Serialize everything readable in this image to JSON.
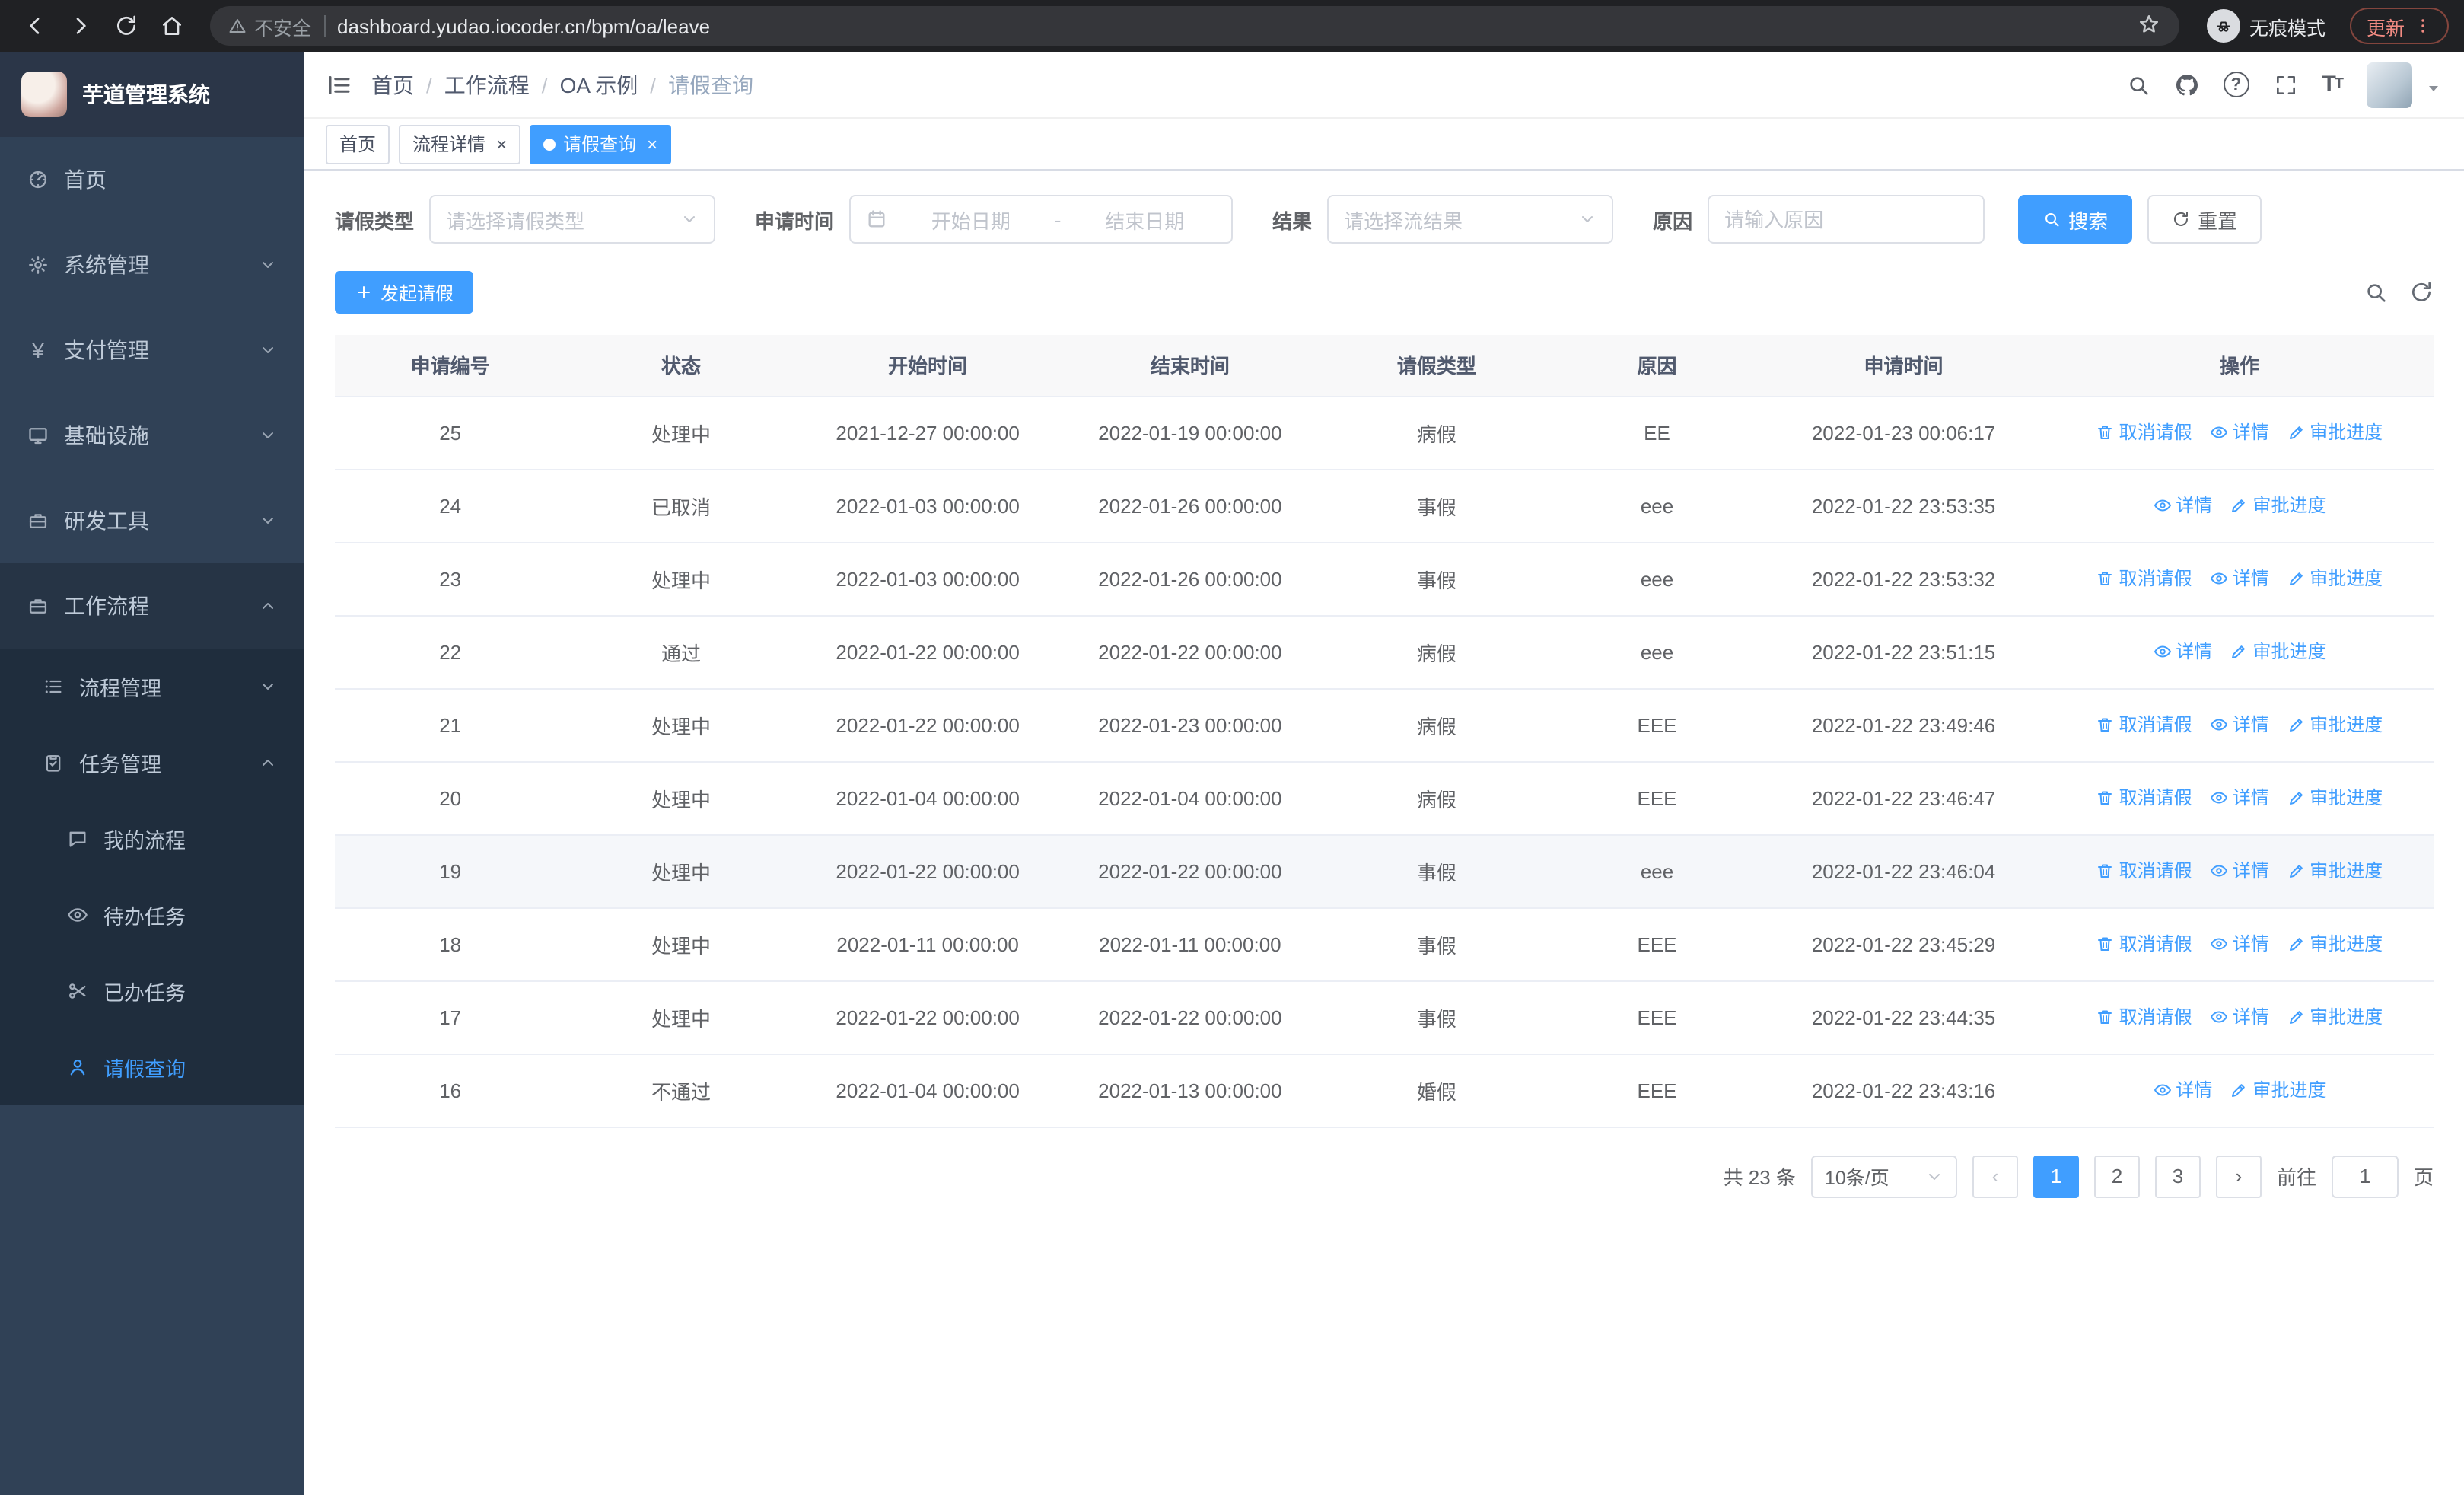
{
  "browser": {
    "security_label": "不安全",
    "url": "dashboard.yudao.iocoder.cn/bpm/oa/leave",
    "incognito_label": "无痕模式",
    "update_label": "更新"
  },
  "sidebar": {
    "logo_title": "芋道管理系统",
    "items": [
      {
        "label": "首页"
      },
      {
        "label": "系统管理"
      },
      {
        "label": "支付管理"
      },
      {
        "label": "基础设施"
      },
      {
        "label": "研发工具"
      },
      {
        "label": "工作流程"
      }
    ],
    "workflow_children": [
      {
        "label": "流程管理"
      },
      {
        "label": "任务管理"
      }
    ],
    "task_children": [
      {
        "label": "我的流程"
      },
      {
        "label": "待办任务"
      },
      {
        "label": "已办任务"
      },
      {
        "label": "请假查询"
      }
    ]
  },
  "header": {
    "breadcrumb": [
      "首页",
      "工作流程",
      "OA 示例",
      "请假查询"
    ]
  },
  "tabs": [
    {
      "label": "首页"
    },
    {
      "label": "流程详情"
    },
    {
      "label": "请假查询"
    }
  ],
  "filters": {
    "leave_type_label": "请假类型",
    "leave_type_placeholder": "请选择请假类型",
    "apply_time_label": "申请时间",
    "start_date_placeholder": "开始日期",
    "range_separator": "-",
    "end_date_placeholder": "结束日期",
    "result_label": "结果",
    "result_placeholder": "请选择流结果",
    "reason_label": "原因",
    "reason_placeholder": "请输入原因",
    "search_label": "搜索",
    "reset_label": "重置"
  },
  "toolbar": {
    "create_label": "发起请假"
  },
  "table": {
    "headers": [
      "申请编号",
      "状态",
      "开始时间",
      "结束时间",
      "请假类型",
      "原因",
      "申请时间",
      "操作"
    ],
    "action_labels": {
      "cancel": "取消请假",
      "detail": "详情",
      "progress": "审批进度"
    },
    "rows": [
      {
        "id": "25",
        "status": "处理中",
        "start": "2021-12-27 00:00:00",
        "end": "2022-01-19 00:00:00",
        "type": "病假",
        "reason": "EE",
        "apply": "2022-01-23 00:06:17"
      },
      {
        "id": "24",
        "status": "已取消",
        "start": "2022-01-03 00:00:00",
        "end": "2022-01-26 00:00:00",
        "type": "事假",
        "reason": "eee",
        "apply": "2022-01-22 23:53:35"
      },
      {
        "id": "23",
        "status": "处理中",
        "start": "2022-01-03 00:00:00",
        "end": "2022-01-26 00:00:00",
        "type": "事假",
        "reason": "eee",
        "apply": "2022-01-22 23:53:32"
      },
      {
        "id": "22",
        "status": "通过",
        "start": "2022-01-22 00:00:00",
        "end": "2022-01-22 00:00:00",
        "type": "病假",
        "reason": "eee",
        "apply": "2022-01-22 23:51:15"
      },
      {
        "id": "21",
        "status": "处理中",
        "start": "2022-01-22 00:00:00",
        "end": "2022-01-23 00:00:00",
        "type": "病假",
        "reason": "EEE",
        "apply": "2022-01-22 23:49:46"
      },
      {
        "id": "20",
        "status": "处理中",
        "start": "2022-01-04 00:00:00",
        "end": "2022-01-04 00:00:00",
        "type": "病假",
        "reason": "EEE",
        "apply": "2022-01-22 23:46:47"
      },
      {
        "id": "19",
        "status": "处理中",
        "start": "2022-01-22 00:00:00",
        "end": "2022-01-22 00:00:00",
        "type": "事假",
        "reason": "eee",
        "apply": "2022-01-22 23:46:04"
      },
      {
        "id": "18",
        "status": "处理中",
        "start": "2022-01-11 00:00:00",
        "end": "2022-01-11 00:00:00",
        "type": "事假",
        "reason": "EEE",
        "apply": "2022-01-22 23:45:29"
      },
      {
        "id": "17",
        "status": "处理中",
        "start": "2022-01-22 00:00:00",
        "end": "2022-01-22 00:00:00",
        "type": "事假",
        "reason": "EEE",
        "apply": "2022-01-22 23:44:35"
      },
      {
        "id": "16",
        "status": "不通过",
        "start": "2022-01-04 00:00:00",
        "end": "2022-01-13 00:00:00",
        "type": "婚假",
        "reason": "EEE",
        "apply": "2022-01-22 23:43:16"
      }
    ]
  },
  "pagination": {
    "total_label": "共 23 条",
    "page_size_label": "10条/页",
    "pages": [
      "1",
      "2",
      "3"
    ],
    "active_page": "1",
    "goto_label": "前往",
    "goto_value": "1",
    "page_unit_label": "页"
  },
  "colors": {
    "primary": "#409eff",
    "sidebar_bg": "#304156",
    "sidebar_sub_bg": "#1f2d3d",
    "active_tab_bg": "#409eff"
  }
}
